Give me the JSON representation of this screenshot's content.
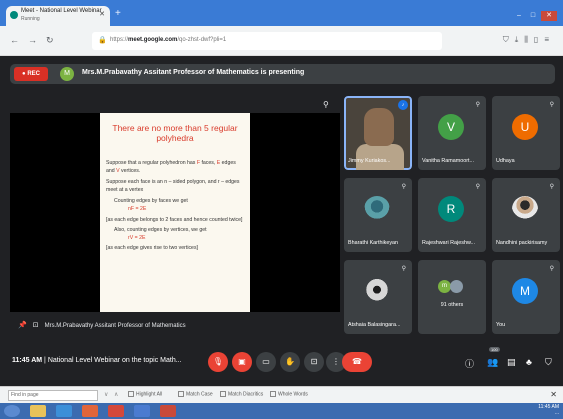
{
  "browser": {
    "tab_title": "Meet - National Level Webinar",
    "tab_subtitle": "Running",
    "url_prefix": "https://",
    "url_domain": "meet.google.com",
    "url_suffix": "/qo-zhst-dwf?pli=1"
  },
  "presenting_bar": {
    "rec_label": "REC",
    "avatar_letter": "M",
    "text": "Mrs.M.Prabavathy Assitant Professor of Mathematics is presenting"
  },
  "slide": {
    "title": "There are no more than 5 regular polyhedra",
    "line1_a": "Suppose that a regular polyhedron has ",
    "line1_f": "F",
    "line1_b": " faces, ",
    "line1_e": "E",
    "line1_c": " edges and ",
    "line1_v": "V",
    "line1_d": " vertices.",
    "line2": "Suppose each face is an n – sided polygon, and r – edges meet at a vertex",
    "line3": "Counting edges by faces we get",
    "eq1": "nF = 2E",
    "line4": "[as each edge belongs to 2 faces and hence counted twice]",
    "line5": "Also, counting edges by vertices, we get",
    "eq2": "rV = 2E",
    "line6": "[as each edge gives rise to two vertices]"
  },
  "presenter_footer": "Mrs.M.Prabavathy Assitant Professor of Mathematics",
  "participants": [
    {
      "name": "Jimmy Kuriakos...",
      "type": "video"
    },
    {
      "name": "Vanitha Ramamoort...",
      "letter": "V",
      "color": "#43a047"
    },
    {
      "name": "Udhaya",
      "letter": "U",
      "color": "#ef6c00"
    },
    {
      "name": "Bharathi Karthikeyan",
      "type": "photo"
    },
    {
      "name": "Rajeshwari Rajeshw...",
      "letter": "R",
      "color": "#00897b"
    },
    {
      "name": "Nandhini packirisamy",
      "type": "photo"
    },
    {
      "name": "Atshaia Balasingara...",
      "type": "photo"
    },
    {
      "name": "91 others",
      "type": "group"
    },
    {
      "name": "You",
      "letter": "M",
      "color": "#1e88e5"
    }
  ],
  "bottom": {
    "time": "11:45 AM",
    "separator": "|",
    "meeting_title": "National Level Webinar on the topic Math...",
    "people_count": "100"
  },
  "find_bar": {
    "placeholder": "Find in page",
    "highlight_all": "Highlight All",
    "match_case": "Match Case",
    "match_diacritics": "Match Diacritics",
    "whole_words": "Whole Words"
  },
  "taskbar": {
    "time": "11:45 AM",
    "date": "..."
  },
  "colors": {
    "accent": "#1a73e8",
    "danger": "#ea4335",
    "meet_bg": "#202124",
    "tile_bg": "#3c4043"
  }
}
